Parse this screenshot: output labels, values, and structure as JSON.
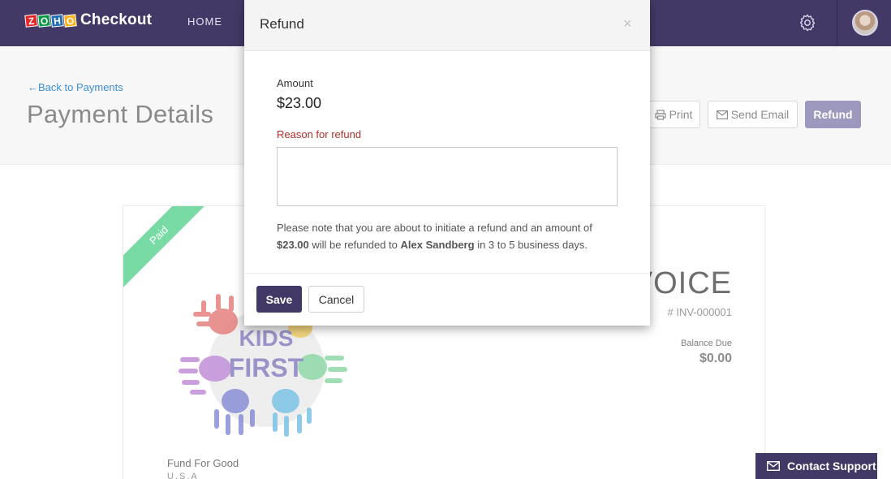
{
  "nav": {
    "logo_letters": [
      "Z",
      "O",
      "H",
      "O"
    ],
    "product": "Checkout",
    "home": "HOME",
    "settings_icon": "gear-icon",
    "avatar_icon": "user-avatar"
  },
  "header": {
    "back_arrow": "←",
    "back_link": "Back to Payments",
    "title": "Payment Details",
    "print_label": "Print",
    "send_email_label": "Send Email",
    "refund_label": "Refund"
  },
  "invoice": {
    "status_ribbon": "Paid",
    "title": "INVOICE",
    "number": "# INV-000001",
    "balance_due_label": "Balance Due",
    "balance_due_value": "$0.00",
    "logo_word1": "KIDS",
    "logo_word2": "FIRST",
    "company_name": "Fund For Good",
    "company_country": "U.S.A"
  },
  "modal": {
    "title": "Refund",
    "close": "×",
    "amount_label": "Amount",
    "amount_value": "$23.00",
    "reason_label": "Reason for refund",
    "reason_value": "",
    "note_prefix": "Please note that you are about to initiate a refund and an amount of",
    "note_amount": "$23.00",
    "note_middle": "will be refunded to",
    "note_customer": "Alex Sandberg",
    "note_suffix": "in 3 to 5 business days.",
    "save_label": "Save",
    "cancel_label": "Cancel"
  },
  "support": {
    "label": "Contact Support"
  },
  "colors": {
    "brand": "#433966",
    "refund_button": "#9d98bd",
    "paid_ribbon": "#78dba6",
    "reason_label": "#b0302a",
    "link": "#3d8fd6"
  }
}
